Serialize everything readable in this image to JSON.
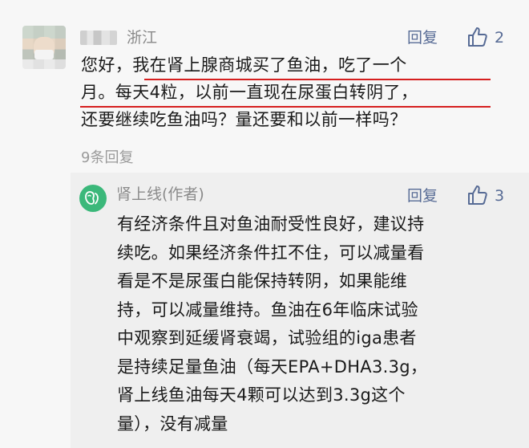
{
  "comment": {
    "location": "浙江",
    "reply_label": "回复",
    "likes": "2",
    "lines": [
      "您好，我在肾上腺商城买了鱼油，吃了一个",
      "月。每天4粒，以前一直现在尿蛋白转阴了，",
      "还要继续吃鱼油吗？量还要和以前一样吗？"
    ],
    "reply_count": "9条回复"
  },
  "author_reply": {
    "name": "肾上线(作者)",
    "reply_label": "回复",
    "likes": "3",
    "lines": [
      "有经济条件且对鱼油耐受性良好，建议持",
      "续吃。如果经济条件扛不住，可以减量看",
      "看是不是尿蛋白能保持转阴，如果能维",
      "持，可以减量维持。鱼油在6年临床试验",
      "中观察到延缓肾衰竭，试验组的iga患者",
      "是持续足量鱼油（每天EPA+DHA3.3g，",
      "肾上线鱼油每天4颗可以达到3.3g这个",
      "量），没有减量"
    ]
  },
  "colors": {
    "link": "#576b95",
    "underline": "#d61f1f",
    "avatar_green": "#3bb87a"
  },
  "icons": {
    "like": "thumbs-up-icon",
    "author_avatar": "kidney-logo-icon"
  }
}
